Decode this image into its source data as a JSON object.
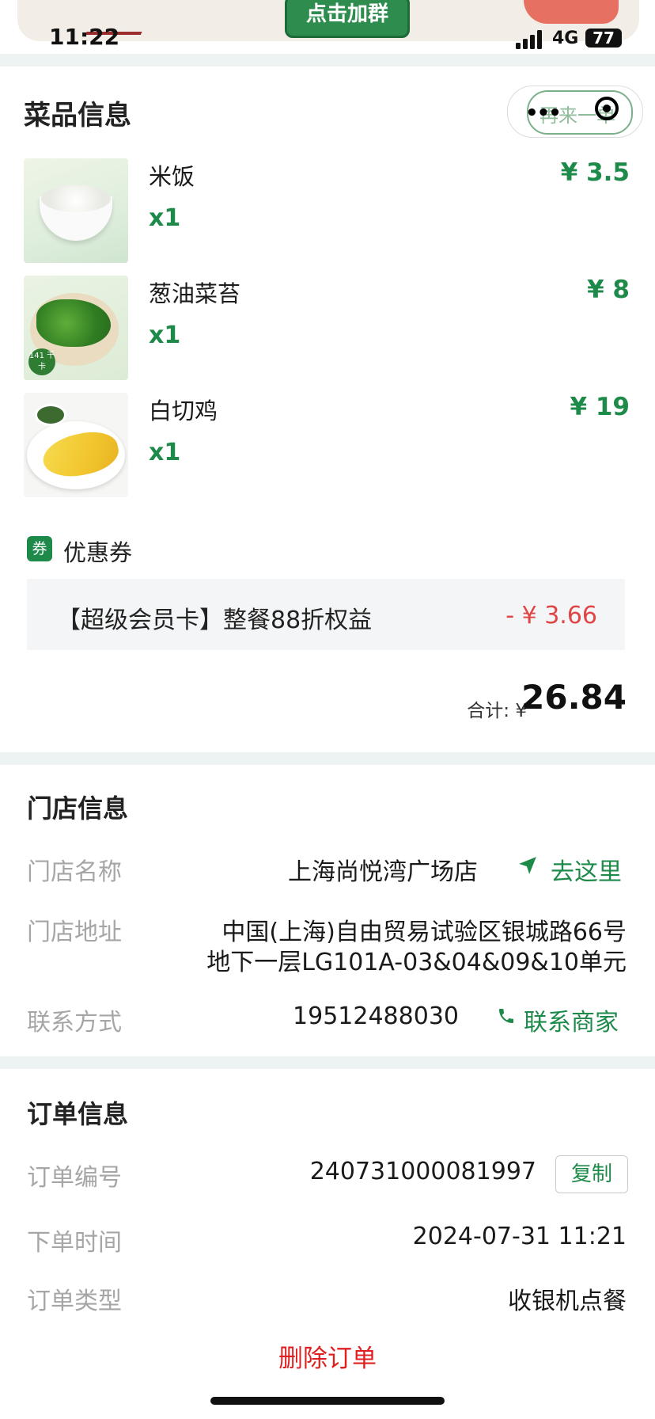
{
  "status_bar": {
    "time": "11:22",
    "network": "4G",
    "battery": "77"
  },
  "banner": {
    "button_label": "点击加群"
  },
  "dishes_section": {
    "title": "菜品信息",
    "capsule_text": "再来一单",
    "items": [
      {
        "name": "米饭",
        "qty": "x1",
        "price": "¥ 3.5"
      },
      {
        "name": "葱油菜苔",
        "qty": "x1",
        "price": "¥ 8",
        "badge": "141 千卡"
      },
      {
        "name": "白切鸡",
        "qty": "x1",
        "price": "¥ 19"
      }
    ]
  },
  "coupon": {
    "icon": "券",
    "title": "优惠券",
    "name": "【超级会员卡】整餐88折权益",
    "amount": "- ¥ 3.66"
  },
  "total": {
    "label": "合计: ¥",
    "value": "26.84"
  },
  "store": {
    "title": "门店信息",
    "name_label": "门店名称",
    "name_value": "上海尚悦湾广场店",
    "navigate_label": "去这里",
    "address_label": "门店地址",
    "address_line1": "中国(上海)自由贸易试验区银城路66号",
    "address_line2": "地下一层LG101A-03&04&09&10单元",
    "contact_label": "联系方式",
    "contact_value": "19512488030",
    "contact_link": "联系商家"
  },
  "order": {
    "title": "订单信息",
    "number_label": "订单编号",
    "number_value": "240731000081997",
    "copy_label": "复制",
    "time_label": "下单时间",
    "time_value": "2024-07-31 11:21",
    "type_label": "订单类型",
    "type_value": "收银机点餐",
    "delete_label": "删除订单"
  },
  "colors": {
    "accent": "#1e8a4a",
    "danger": "#e02020",
    "muted": "#a6a6a6",
    "separator": "#edf2f2"
  }
}
